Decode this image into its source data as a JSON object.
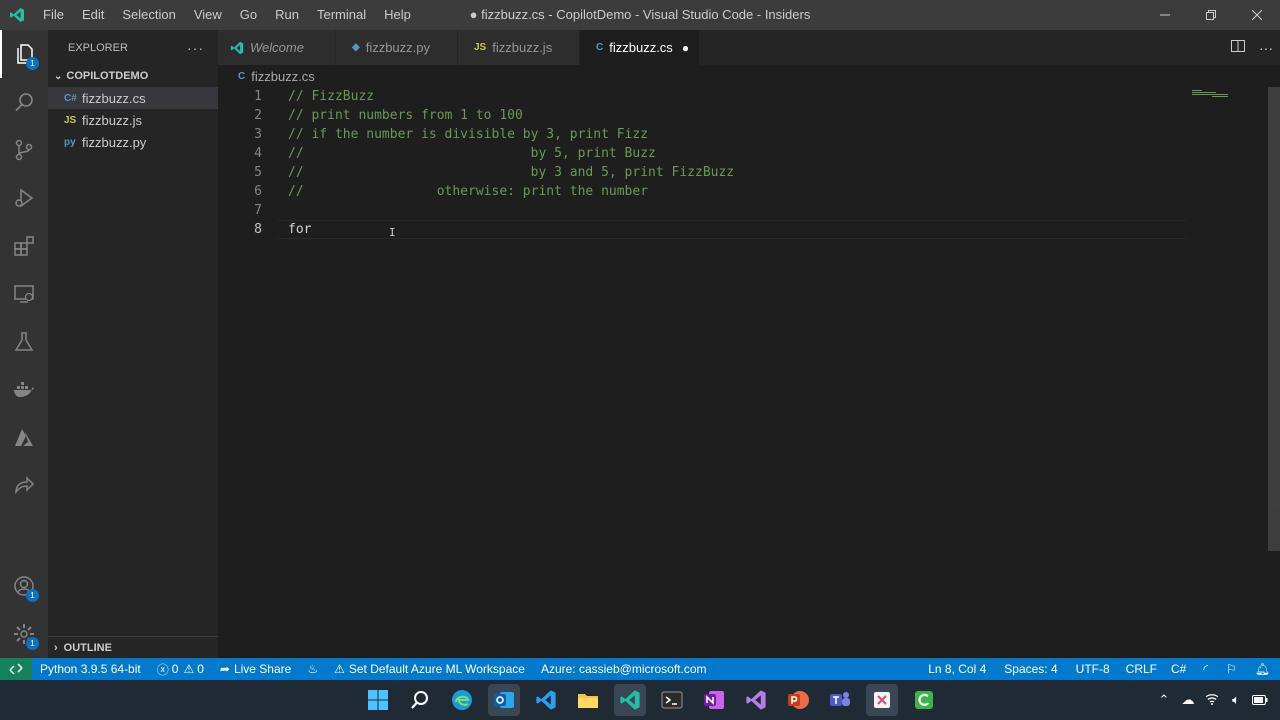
{
  "titlebar": {
    "menu": [
      "File",
      "Edit",
      "Selection",
      "View",
      "Go",
      "Run",
      "Terminal",
      "Help"
    ],
    "title": "● fizzbuzz.cs - CopilotDemo - Visual Studio Code - Insiders"
  },
  "activity": {
    "explorer_badge": "1",
    "accounts_badge": "1",
    "settings_badge": "1"
  },
  "sidebar": {
    "header": "EXPLORER",
    "folder": "COPILOTDEMO",
    "files": [
      {
        "name": "fizzbuzz.cs",
        "icon": "C#"
      },
      {
        "name": "fizzbuzz.js",
        "icon": "JS"
      },
      {
        "name": "fizzbuzz.py",
        "icon": "py"
      }
    ],
    "outline": "OUTLINE"
  },
  "tabs": [
    {
      "label": "Welcome"
    },
    {
      "label": "fizzbuzz.py"
    },
    {
      "label": "fizzbuzz.js",
      "icon": "JS"
    },
    {
      "label": "fizzbuzz.cs",
      "dirty": "●"
    }
  ],
  "breadcrumb": "fizzbuzz.cs",
  "editor": {
    "lines": [
      {
        "n": "1",
        "text": "// FizzBuzz"
      },
      {
        "n": "2",
        "text": "// print numbers from 1 to 100"
      },
      {
        "n": "3",
        "text": "// if the number is divisible by 3, print Fizz"
      },
      {
        "n": "4",
        "text": "//                             by 5, print Buzz"
      },
      {
        "n": "5",
        "text": "//                             by 3 and 5, print FizzBuzz"
      },
      {
        "n": "6",
        "text": "//                 otherwise: print the number"
      },
      {
        "n": "7",
        "text": ""
      },
      {
        "n": "8",
        "text": "for"
      }
    ]
  },
  "status": {
    "python": "Python 3.9.5 64-bit",
    "errors": "0",
    "warnings": "0",
    "liveshare": "Live Share",
    "azureml": "Set Default Azure ML Workspace",
    "azure": "Azure: cassieb@microsoft.com",
    "position": "Ln 8, Col 4",
    "spaces": "Spaces: 4",
    "encoding": "UTF-8",
    "eol": "CRLF",
    "language": "C#"
  }
}
